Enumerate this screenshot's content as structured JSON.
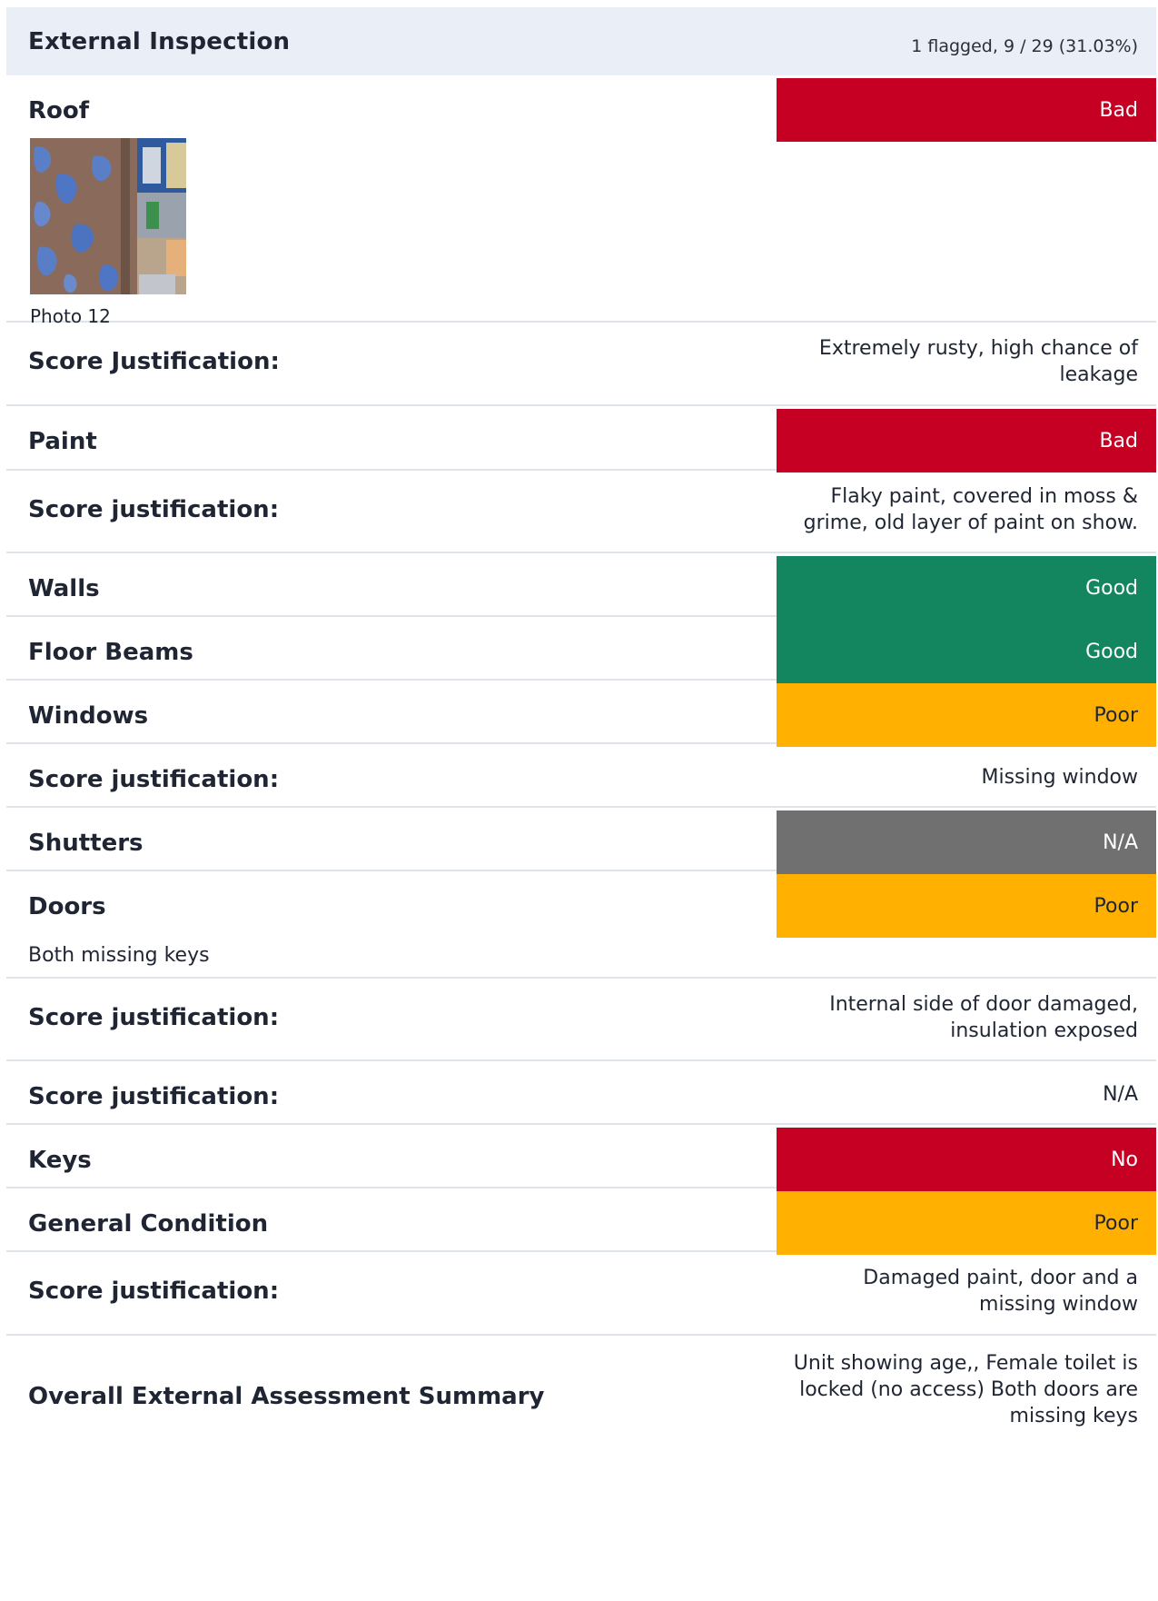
{
  "section": {
    "title": "External Inspection",
    "meta": "1 flagged, 9 / 29 (31.03%)"
  },
  "roof": {
    "label": "Roof",
    "rating": "Bad",
    "photo_caption": "Photo 12",
    "justification_label": "Score Justification:",
    "justification_line1": "Extremely rusty, high chance of",
    "justification_line2": "leakage"
  },
  "paint": {
    "label": "Paint",
    "rating": "Bad",
    "justification_label": "Score justification:",
    "justification_line1": "Flaky paint, covered in moss &",
    "justification_line2": "grime, old layer of paint on show."
  },
  "walls": {
    "label": "Walls",
    "rating": "Good"
  },
  "floor_beams": {
    "label": "Floor Beams",
    "rating": "Good"
  },
  "windows": {
    "label": "Windows",
    "rating": "Poor",
    "justification_label": "Score justification:",
    "justification": "Missing window"
  },
  "shutters": {
    "label": "Shutters",
    "rating": "N/A"
  },
  "doors": {
    "label": "Doors",
    "rating": "Poor",
    "note": "Both missing keys",
    "justification_label": "Score justification:",
    "justification_line1": "Internal side of door damaged,",
    "justification_line2": "insulation exposed",
    "justification2_label": "Score justification:",
    "justification2": "N/A"
  },
  "keys": {
    "label": "Keys",
    "rating": "No"
  },
  "general_condition": {
    "label": "General Condition",
    "rating": "Poor",
    "justification_label": "Score justification:",
    "justification_line1": "Damaged paint, door and a",
    "justification_line2": "missing window"
  },
  "summary": {
    "label": "Overall External Assessment Summary",
    "line1": "Unit showing age,, Female toilet is",
    "line2": "locked (no access) Both doors are",
    "line3": "missing keys"
  },
  "colors": {
    "bad": "#c60022",
    "good": "#13855f",
    "poor": "#ffb000",
    "na": "#707070",
    "header_bg": "#e9eef7"
  }
}
